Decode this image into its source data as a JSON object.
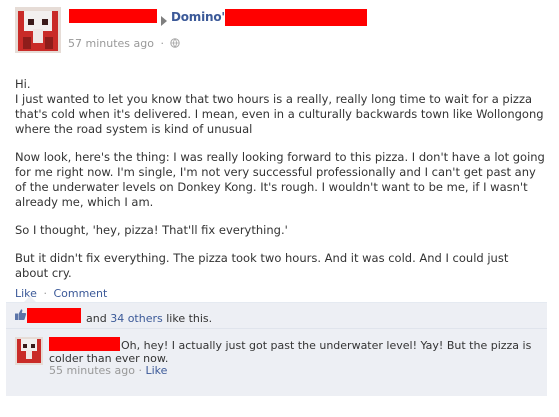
{
  "story": {
    "page_name": "Domino's",
    "timestamp": "57 minutes ago",
    "separator": "·",
    "privacy_icon": "globe-icon",
    "body": [
      "Hi.",
      "I just wanted to let you know that two hours is a really, really long time to wait for a pizza that's cold when it's delivered. I mean, even in a culturally backwards town like Wollongong where the road system is kind of unusual",
      "Now look, here's the thing: I was really looking forward to this pizza. I don't have a lot going for me right now. I'm single, I'm not very successful professionally and I can't get past any of the underwater levels on Donkey Kong. It's rough. I wouldn't want to be me, if I wasn't already me, which I am.",
      "So I thought, 'hey, pizza! That'll fix everything.'",
      "But it didn't fix everything. The pizza took two hours. And it was cold. And I could just about cry."
    ]
  },
  "actions": {
    "like": "Like",
    "separator": "·",
    "comment": "Comment"
  },
  "likes": {
    "icon": "thumbs-up-icon",
    "prefix": "and",
    "others_link": "34 others",
    "suffix": "like this."
  },
  "comment": {
    "text": "Oh, hey! I actually just got past the underwater level! Yay! But the pizza is colder than ever now.",
    "timestamp": "55 minutes ago",
    "separator": "·",
    "like": "Like"
  },
  "colors": {
    "link": "#3b5998",
    "redaction": "#ff0000",
    "ufi_background": "#edeff4",
    "meta_text": "#999999"
  }
}
